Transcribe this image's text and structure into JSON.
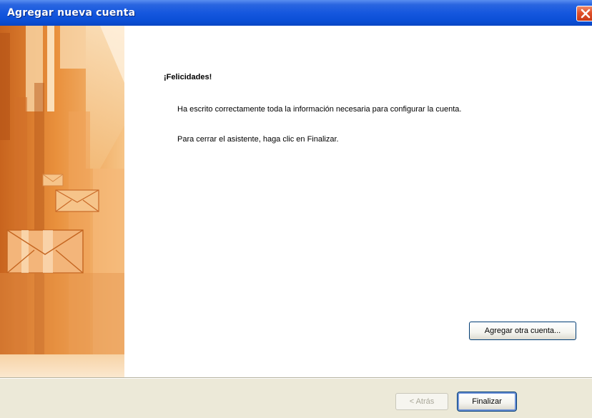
{
  "window": {
    "title": "Agregar nueva cuenta",
    "close_icon": "close-icon"
  },
  "banner": {
    "description_icons": [
      "envelope-icon",
      "envelope-icon",
      "envelope-icon"
    ]
  },
  "content": {
    "heading": "¡Felicidades!",
    "message_1": "Ha escrito correctamente toda la información necesaria para configurar la cuenta.",
    "message_2": "Para cerrar el asistente, haga clic en Finalizar.",
    "add_account_label": "Agregar otra cuenta..."
  },
  "footer": {
    "back_label": "< Atrás",
    "finish_label": "Finalizar"
  },
  "colors": {
    "titlebar": "#0b4fd6",
    "close_button": "#e0502a",
    "dialog_background": "#ece9d8",
    "banner_orange": "#f0a860"
  }
}
